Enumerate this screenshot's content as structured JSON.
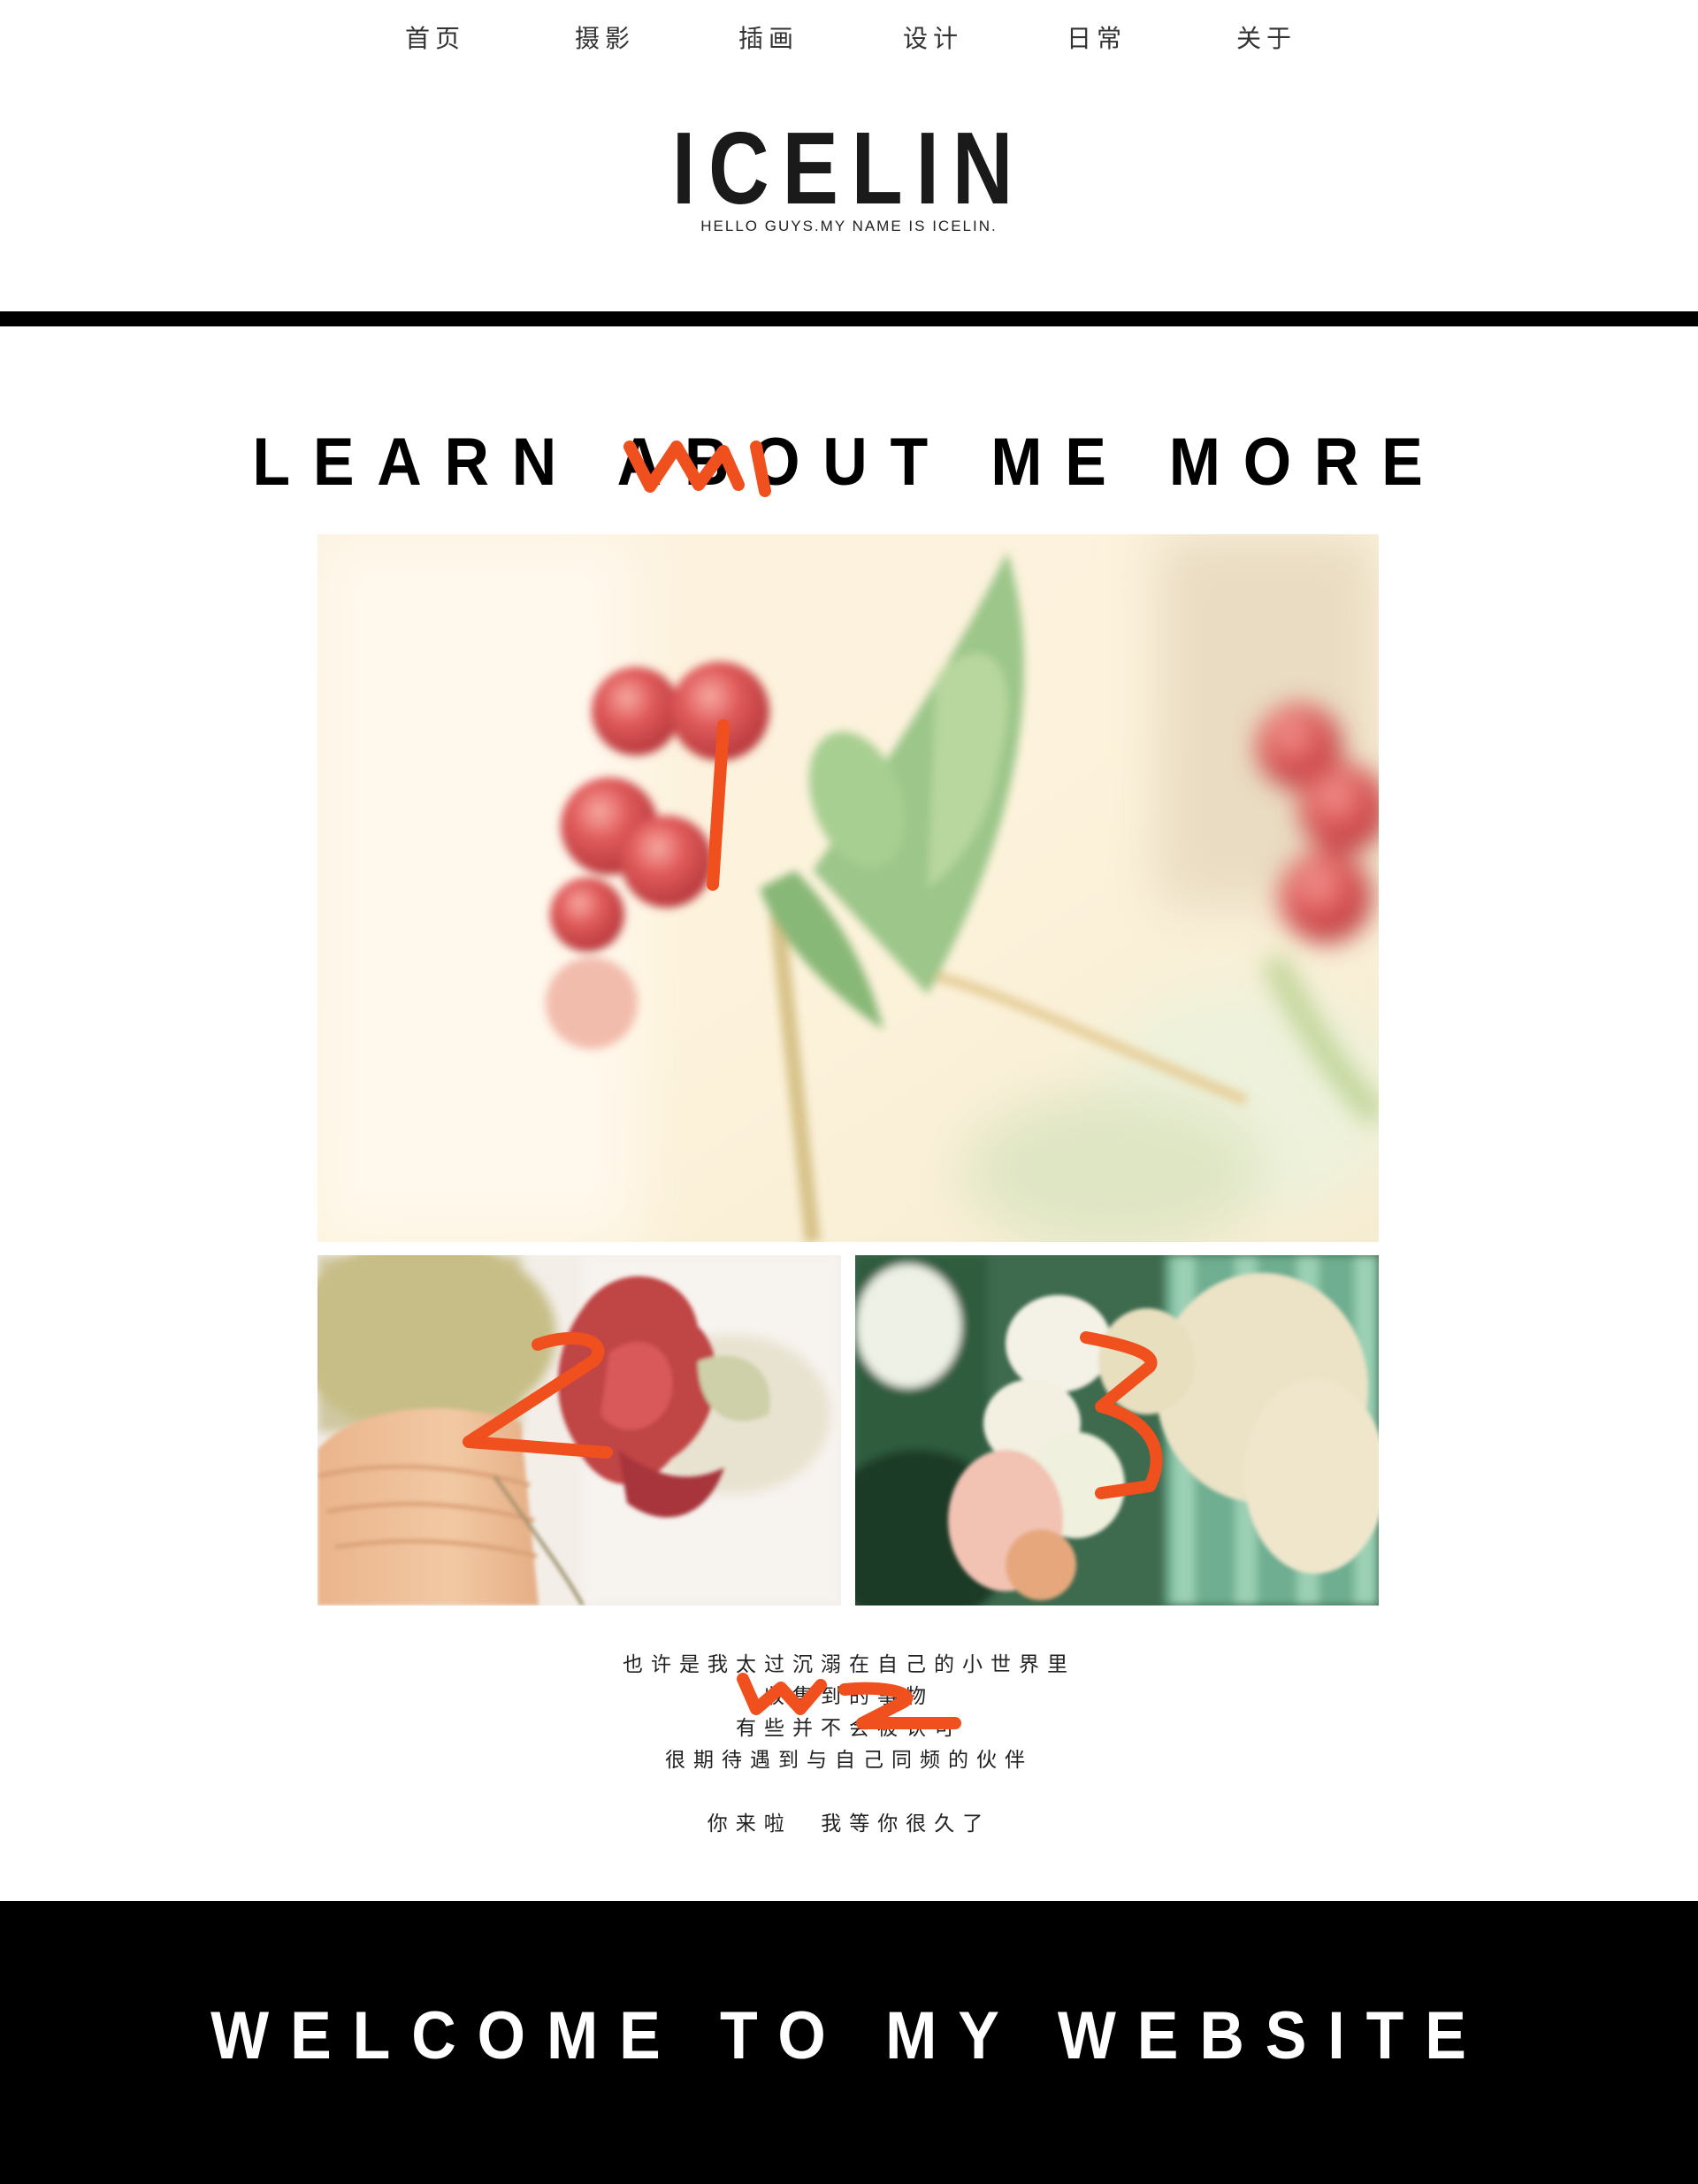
{
  "nav": {
    "items": [
      {
        "label": "首页"
      },
      {
        "label": "摄影"
      },
      {
        "label": "插画"
      },
      {
        "label": "设计"
      },
      {
        "label": "日常"
      },
      {
        "label": "关于"
      }
    ]
  },
  "header": {
    "logo": "ICELIN",
    "tagline": "HELLO GUYS.MY NAME IS ICELIN."
  },
  "about": {
    "heading": "LEARN ABOUT ME MORE",
    "poem": [
      "也许是我太过沉溺在自己的小世界里",
      "收集到的事物",
      "有些并不会被认可",
      "很期待遇到与自己同频的伙伴",
      "",
      "你来啦  我等你很久了"
    ]
  },
  "footer": {
    "title": "WELCOME TO MY WEBSITE"
  },
  "annotations": {
    "marker_color": "#f0501e",
    "labels": [
      "W1",
      "1",
      "2",
      "3",
      "W2"
    ]
  }
}
